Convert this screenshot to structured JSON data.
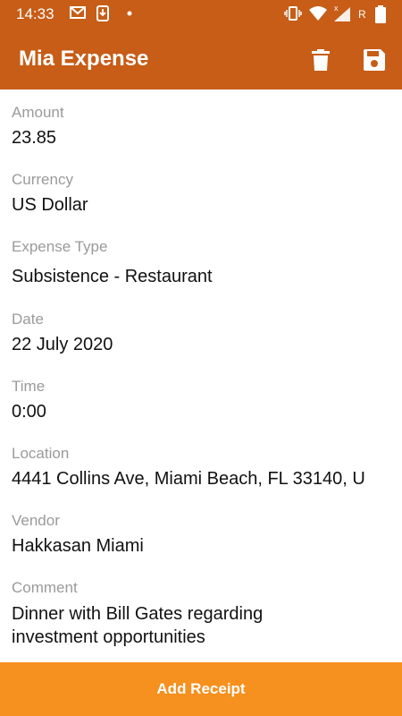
{
  "status_bar": {
    "time": "14:33"
  },
  "app_bar": {
    "title": "Mia Expense",
    "delete_icon": "trash-icon",
    "save_icon": "floppy-disk-icon"
  },
  "fields": {
    "amount": {
      "label": "Amount",
      "value": "23.85"
    },
    "currency": {
      "label": "Currency",
      "value": "US Dollar"
    },
    "expense_type": {
      "label": "Expense Type",
      "value": "Subsistence - Restaurant"
    },
    "date": {
      "label": "Date",
      "value": "22 July 2020"
    },
    "time": {
      "label": "Time",
      "value": "0:00"
    },
    "location": {
      "label": "Location",
      "value": "4441 Collins Ave, Miami Beach, FL 33140, U"
    },
    "vendor": {
      "label": "Vendor",
      "value": "Hakkasan Miami"
    },
    "comment": {
      "label": "Comment",
      "value": "Dinner with Bill Gates regarding investment opportunities"
    }
  },
  "footer": {
    "add_receipt_label": "Add Receipt"
  },
  "colors": {
    "primary": "#c75d17",
    "accent": "#f6901e",
    "label": "#9a9a9a"
  }
}
